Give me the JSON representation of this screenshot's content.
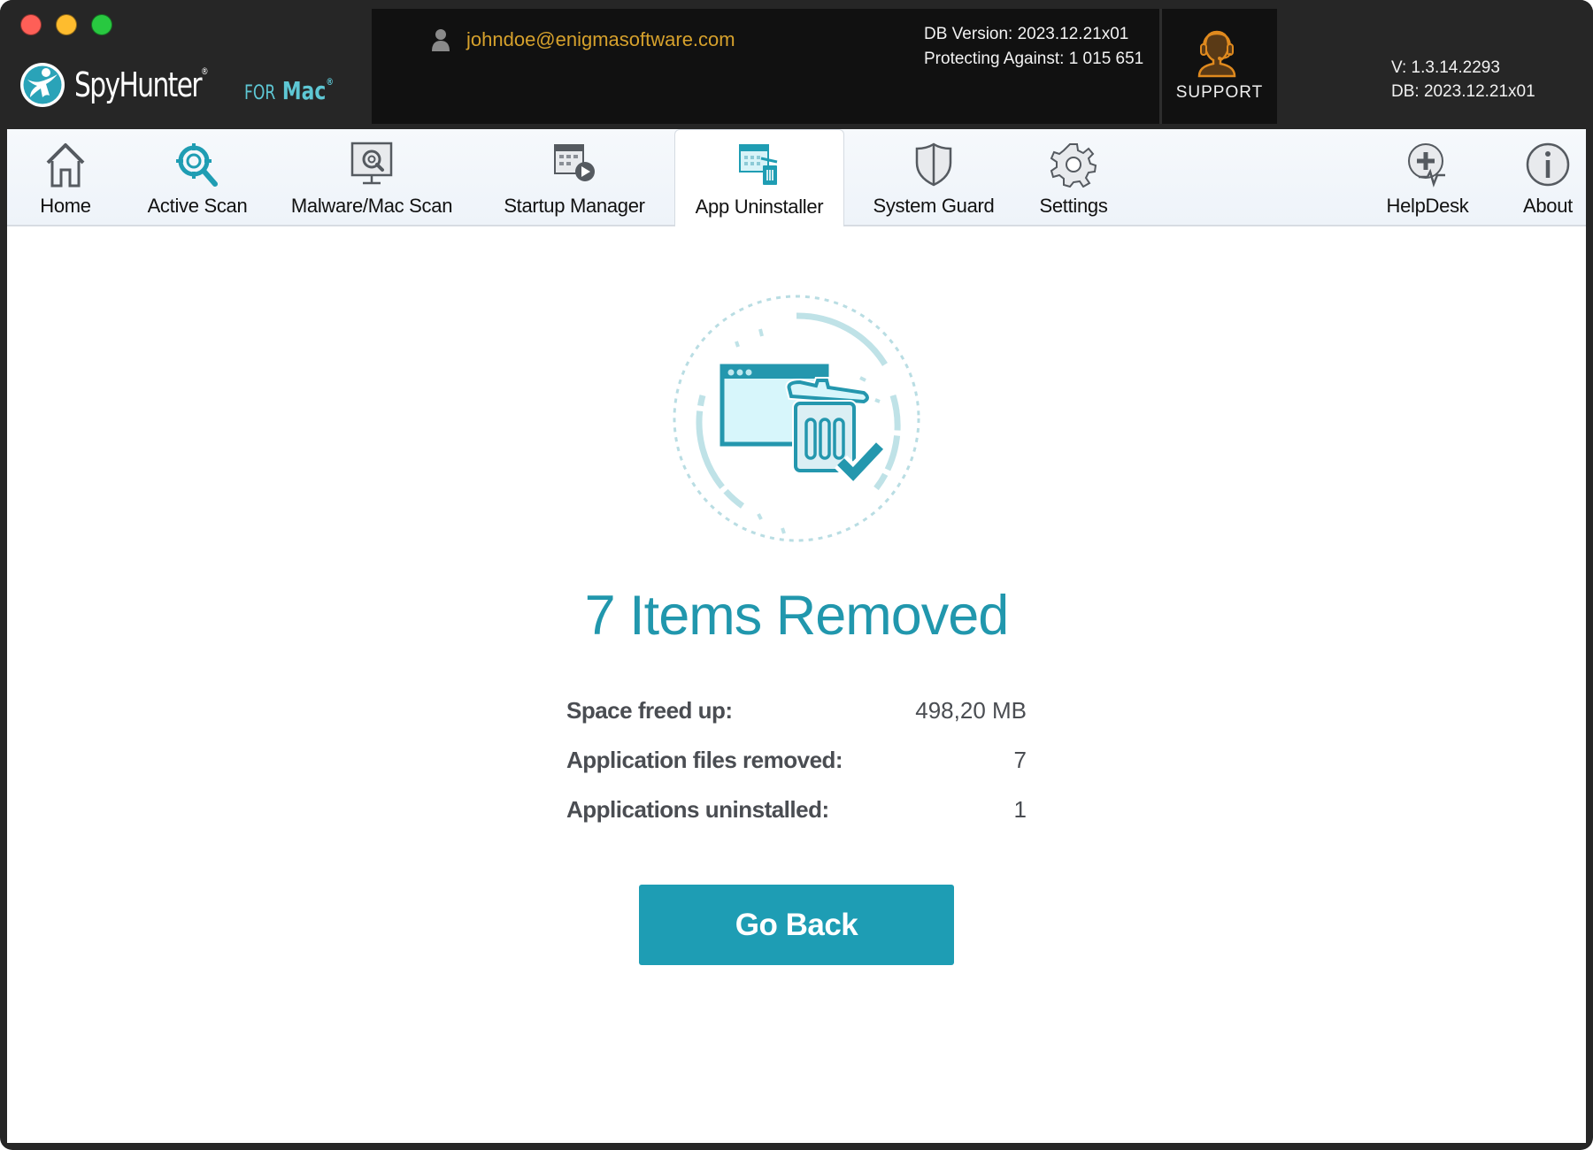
{
  "window": {
    "app_name": "SpyHunter",
    "app_suffix_for": "FOR",
    "app_suffix_platform": "Mac",
    "registered_mark": "®"
  },
  "header": {
    "user_email": "johndoe@enigmasoftware.com",
    "db_version": "DB Version: 2023.12.21x01",
    "protecting_against": "Protecting Against: 1 015 651",
    "support_label": "SUPPORT",
    "app_version": "V: 1.3.14.2293",
    "db_short": "DB:  2023.12.21x01"
  },
  "nav": {
    "items": [
      {
        "label": "Home",
        "icon": "home-icon"
      },
      {
        "label": "Active Scan",
        "icon": "active-scan-icon"
      },
      {
        "label": "Malware/Mac Scan",
        "icon": "malware-scan-icon"
      },
      {
        "label": "Startup Manager",
        "icon": "startup-manager-icon"
      },
      {
        "label": "App Uninstaller",
        "icon": "app-uninstaller-icon",
        "active": true
      },
      {
        "label": "System Guard",
        "icon": "shield-icon"
      },
      {
        "label": "Settings",
        "icon": "gear-icon"
      },
      {
        "label": "HelpDesk",
        "icon": "helpdesk-icon"
      },
      {
        "label": "About",
        "icon": "info-icon"
      }
    ]
  },
  "result": {
    "title": "7 Items Removed",
    "stats": [
      {
        "label": "Space freed up:",
        "value": "498,20 MB"
      },
      {
        "label": "Application files removed:",
        "value": "7"
      },
      {
        "label": "Applications uninstalled:",
        "value": "1"
      }
    ],
    "go_back_label": "Go Back"
  },
  "colors": {
    "accent": "#1e9db4",
    "title": "#2197ad",
    "email": "#d6a12c",
    "support_icon": "#e08a1e",
    "titlebar": "#262626"
  }
}
